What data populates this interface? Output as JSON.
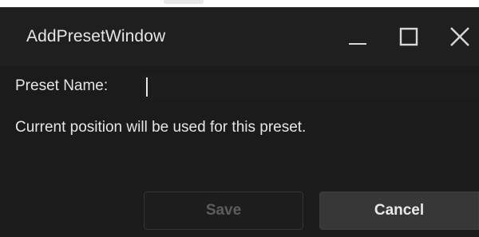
{
  "window": {
    "title": "AddPresetWindow",
    "controls": {
      "minimize_icon": "minimize-icon",
      "maximize_icon": "maximize-icon",
      "close_icon": "close-icon"
    }
  },
  "form": {
    "name_label": "Preset Name:",
    "name_value": "",
    "info_text": "Current position will be used for this preset."
  },
  "buttons": {
    "save_label": "Save",
    "save_enabled": false,
    "cancel_label": "Cancel"
  },
  "colors": {
    "background": "#1b1b1b",
    "titlebar": "#1f1f1f",
    "text": "#e6e6e6",
    "disabled_text": "#5d5d5d",
    "cancel_bg": "#373737"
  }
}
